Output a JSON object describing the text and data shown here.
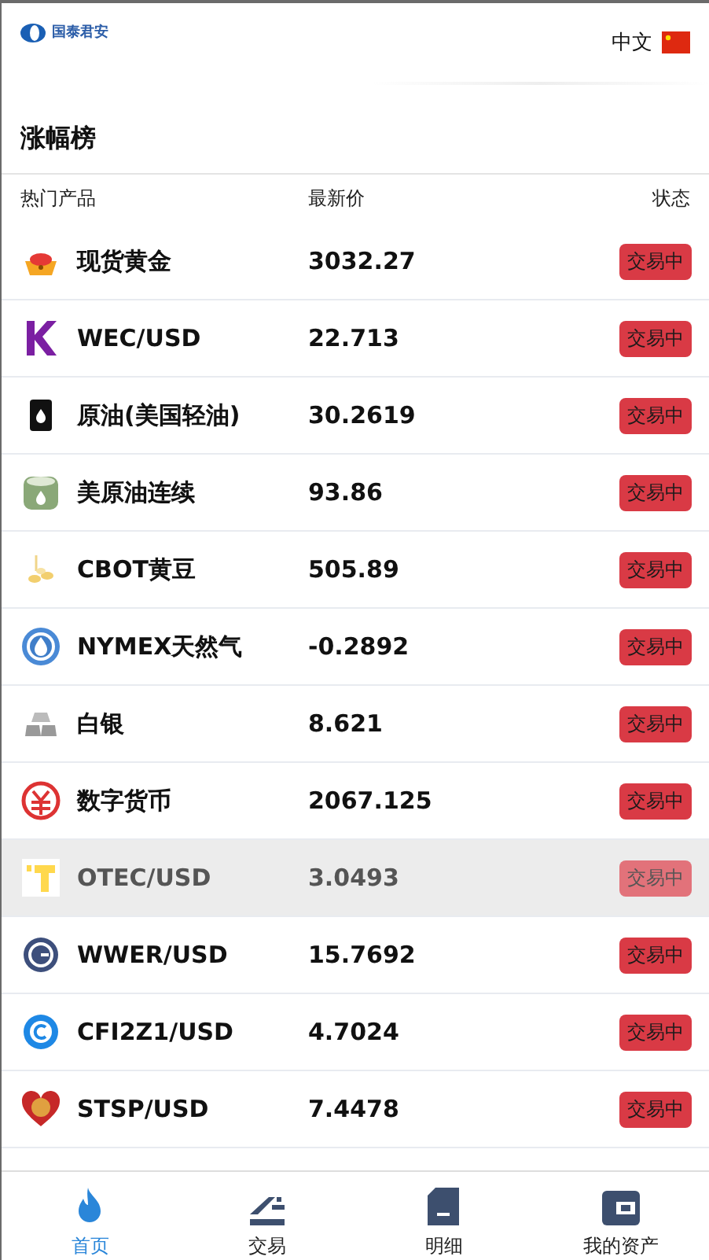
{
  "header": {
    "logo": "国泰君安",
    "language": "中文"
  },
  "title": "涨幅榜",
  "columns": [
    "热门产品",
    "最新价",
    "状态"
  ],
  "rows": [
    {
      "name": "现货黄金",
      "price": "3032.27",
      "status": "交易中",
      "selected": false
    },
    {
      "name": "WEC/USD",
      "price": "22.713",
      "status": "交易中",
      "selected": false
    },
    {
      "name": "原油(美国轻油)",
      "price": "30.2619",
      "status": "交易中",
      "selected": false
    },
    {
      "name": "美原油连续",
      "price": "93.86",
      "status": "交易中",
      "selected": false
    },
    {
      "name": "CBOT黄豆",
      "price": "505.89",
      "status": "交易中",
      "selected": false
    },
    {
      "name": "NYMEX天然气",
      "price": "-0.2892",
      "status": "交易中",
      "selected": false
    },
    {
      "name": "白银",
      "price": "8.621",
      "status": "交易中",
      "selected": false
    },
    {
      "name": "数字货币",
      "price": "2067.125",
      "status": "交易中",
      "selected": false
    },
    {
      "name": "OTEC/USD",
      "price": "3.0493",
      "status": "交易中",
      "selected": true
    },
    {
      "name": "WWER/USD",
      "price": "15.7692",
      "status": "交易中",
      "selected": false
    },
    {
      "name": "CFI2Z1/USD",
      "price": "4.7024",
      "status": "交易中",
      "selected": false
    },
    {
      "name": "STSP/USD",
      "price": "7.4478",
      "status": "交易中",
      "selected": false
    }
  ],
  "tabs": [
    {
      "label": "首页",
      "selected": true
    },
    {
      "label": "交易",
      "selected": false
    },
    {
      "label": "明细",
      "selected": false
    },
    {
      "label": "我的资产",
      "selected": false
    }
  ]
}
